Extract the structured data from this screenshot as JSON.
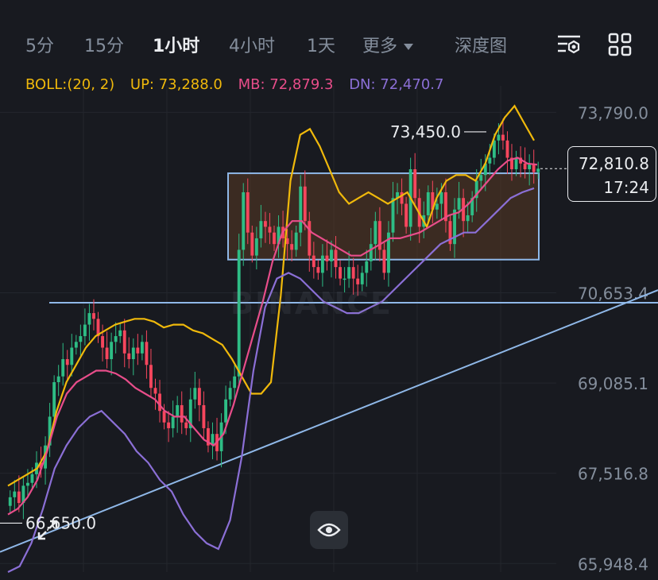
{
  "tabs": [
    {
      "label": "5分",
      "active": false
    },
    {
      "label": "15分",
      "active": false
    },
    {
      "label": "1小时",
      "active": true
    },
    {
      "label": "4小时",
      "active": false
    },
    {
      "label": "1天",
      "active": false
    },
    {
      "label": "更多",
      "active": false
    },
    {
      "label": "深度图",
      "active": false
    }
  ],
  "toolbar_icons": [
    "indicator-settings-icon",
    "grid-layout-icon"
  ],
  "indicator": {
    "name": "BOLL:(20, 2)",
    "up": "UP: 73,288.0",
    "mb": "MB: 72,879.3",
    "dn": "DN: 72,470.7"
  },
  "colors": {
    "background": "#181a20",
    "up_candle": "#2ebd85",
    "down_candle": "#f6465d",
    "boll_up": "#f0b90b",
    "boll_mb": "#e84d8a",
    "boll_dn": "#8b6fd6",
    "trendline": "#8fb8e8",
    "zone_fill": "#5a3a24"
  },
  "watermark": "BINANCE",
  "current_price": {
    "price": "72,810.8",
    "countdown": "17:24"
  },
  "chart_data": {
    "type": "candlestick",
    "title": "",
    "y_ticks": [
      "73,790.0",
      "70,653.4",
      "69,085.1",
      "67,516.8",
      "65,948.4"
    ],
    "y_tick_values": [
      73790.0,
      70653.4,
      69085.1,
      67516.8,
      65948.4
    ],
    "ylim": [
      65800,
      74250
    ],
    "annotations": {
      "high_label": "73,450.0",
      "low_label": "66,650.0"
    },
    "horizontal_line": 70480,
    "box": {
      "top": 72730,
      "bottom": 71230
    },
    "trendline": {
      "start": [
        0,
        66150
      ],
      "end": [
        1,
        70700
      ]
    },
    "closes": [
      67100,
      67200,
      67000,
      67300,
      67350,
      67500,
      67700,
      67600,
      68000,
      68500,
      69100,
      69200,
      69500,
      69400,
      69700,
      69800,
      69900,
      70100,
      70300,
      70200,
      69900,
      69700,
      69500,
      69800,
      69900,
      70000,
      69600,
      69500,
      69700,
      69600,
      69800,
      69400,
      69000,
      68900,
      68600,
      68400,
      68300,
      68500,
      68700,
      68400,
      68300,
      68800,
      69000,
      68700,
      68300,
      68000,
      68200,
      67900,
      68400,
      68800,
      69000,
      69200,
      71400,
      72400,
      71700,
      71300,
      71600,
      71900,
      71800,
      71700,
      71500,
      71800,
      71600,
      71500,
      71400,
      71700,
      72500,
      71900,
      71300,
      71100,
      71000,
      71300,
      71200,
      71400,
      71100,
      70900,
      70900,
      71100,
      70900,
      70800,
      71000,
      71200,
      71500,
      71900,
      71400,
      71000,
      71700,
      72300,
      72400,
      72200,
      71800,
      72800,
      72300,
      71800,
      72000,
      72400,
      72100,
      72200,
      72400,
      71900,
      71500,
      72100,
      72300,
      71900,
      72000,
      72300,
      72600,
      72700,
      72900,
      73000,
      73300,
      73400,
      73300,
      73000,
      72800,
      73000,
      72900,
      72800,
      72900,
      72750,
      72811
    ],
    "boll_up": [
      67300,
      67400,
      67500,
      67600,
      67900,
      68600,
      69100,
      69400,
      69700,
      69900,
      70000,
      70100,
      70150,
      70200,
      70200,
      70150,
      70050,
      70100,
      70100,
      70000,
      69950,
      69850,
      69750,
      69500,
      69200,
      68900,
      68900,
      69100,
      70600,
      72600,
      73400,
      73500,
      73200,
      72800,
      72400,
      72200,
      72300,
      72400,
      72300,
      72200,
      72300,
      72400,
      72100,
      71800,
      72300,
      72600,
      72700,
      72700,
      72600,
      72900,
      73400,
      73700,
      73900,
      73600,
      73300
    ],
    "boll_mb": [
      66800,
      66900,
      67100,
      67400,
      67900,
      68500,
      68900,
      69100,
      69200,
      69300,
      69300,
      69250,
      69150,
      69000,
      68900,
      68800,
      68600,
      68500,
      68500,
      68300,
      68100,
      68000,
      68200,
      68700,
      69300,
      69900,
      70500,
      71200,
      71700,
      71900,
      71900,
      71700,
      71600,
      71500,
      71400,
      71300,
      71300,
      71400,
      71500,
      71600,
      71600,
      71650,
      71700,
      71800,
      71900,
      72000,
      72050,
      72200,
      72400,
      72600,
      72800,
      72950,
      73000,
      72900,
      72879
    ],
    "boll_dn": [
      65800,
      65900,
      66300,
      66900,
      67600,
      68000,
      68300,
      68500,
      68600,
      68400,
      68200,
      67900,
      67700,
      67400,
      67200,
      66800,
      66500,
      66300,
      66200,
      66700,
      67800,
      69300,
      70400,
      70900,
      71000,
      70900,
      70700,
      70500,
      70400,
      70300,
      70300,
      70400,
      70500,
      70700,
      70900,
      71100,
      71300,
      71500,
      71600,
      71700,
      71700,
      71900,
      72100,
      72300,
      72400,
      72470
    ]
  }
}
